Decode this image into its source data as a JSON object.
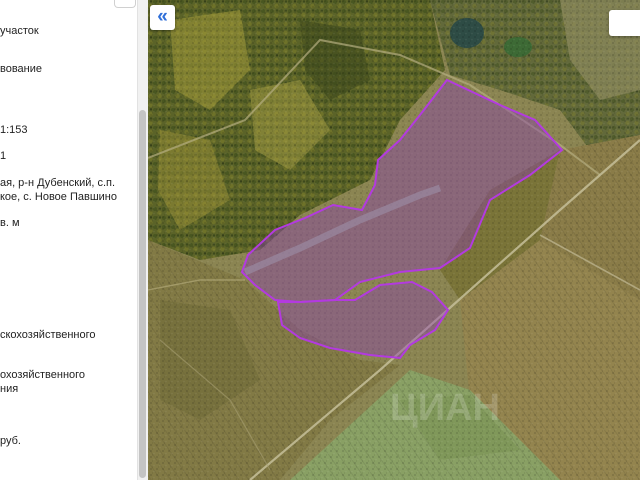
{
  "panel": {
    "rows": [
      {
        "text": " участок"
      },
      {
        "text": "вование"
      },
      {
        "text": "1:153"
      },
      {
        "text": "1"
      },
      {
        "text": "ая, р-н Дубенский, с.п."
      },
      {
        "text": "кое, с. Новое Павшино"
      },
      {
        "text": "в. м"
      },
      {
        "text": "скохозяйственного"
      },
      {
        "text": "охозяйственного"
      },
      {
        "text": "ния"
      },
      {
        "text": " руб."
      }
    ]
  },
  "map": {
    "collapse_label": "«",
    "parcel_color": "#9b2fd0",
    "parcel_fill": "#8a3fb0"
  },
  "colors": {
    "accent": "#2f6fd8"
  }
}
